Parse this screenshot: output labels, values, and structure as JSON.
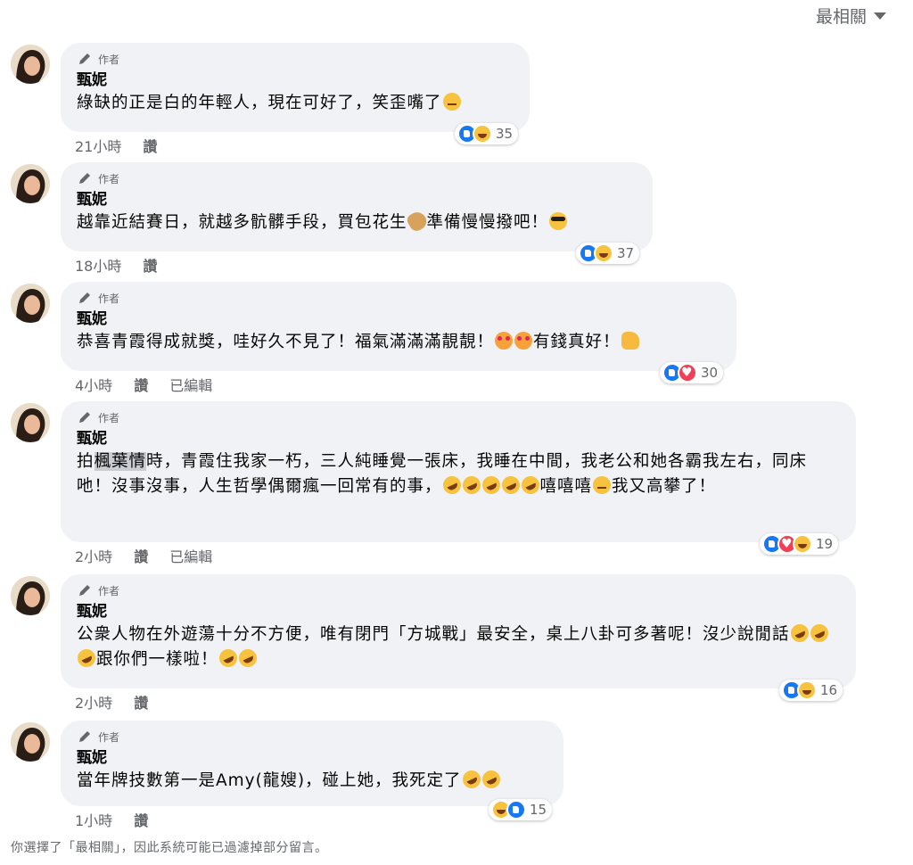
{
  "sort": {
    "label": "最相關"
  },
  "author_badge": "作者",
  "comments": [
    {
      "name": "甄妮",
      "text_parts": [
        "綠缺的正是白的年輕人，現在可好了，笑歪嘴了"
      ],
      "time": "21小時",
      "reply": "讚",
      "edited": "",
      "reaction_count": "35"
    },
    {
      "name": "甄妮",
      "text_parts": [
        "越靠近結賽日，就越多骯髒手段，買包花生",
        "準備慢慢撥吧！"
      ],
      "time": "18小時",
      "reply": "讚",
      "edited": "",
      "reaction_count": "37"
    },
    {
      "name": "甄妮",
      "text_parts": [
        "恭喜青霞得成就獎，哇好久不見了！福氣滿滿滿靚靚！",
        "有錢真好！"
      ],
      "time": "4小時",
      "reply": "讚",
      "edited": "已編輯",
      "reaction_count": "30"
    },
    {
      "name": "甄妮",
      "text_parts": [
        "拍",
        "楓葉情",
        "時，青霞住我家一朽，三人純睡覺一張床，我睡在中間，我老公和她各霸我左右，同床吔！沒事沒事，人生哲學偶爾瘋一回常有的事，",
        "嘻嘻嘻",
        "我又高攀了！"
      ],
      "time": "2小時",
      "reply": "讚",
      "edited": "已編輯",
      "reaction_count": "19"
    },
    {
      "name": "甄妮",
      "text_parts": [
        "公衆人物在外遊蕩十分不方便，唯有閉門「方城戰」最安全，桌上八卦可多著呢！沒少說閒話",
        "跟你們一樣啦！"
      ],
      "time": "2小時",
      "reply": "讚",
      "edited": "",
      "reaction_count": "16"
    },
    {
      "name": "甄妮",
      "text_parts": [
        "當年牌技數第一是Amy(龍嫂)，碰上她，我死定了"
      ],
      "time": "1小時",
      "reply": "讚",
      "edited": "",
      "reaction_count": "15"
    }
  ],
  "footer": "你選擇了「最相關」，因此系統可能已過濾掉部分留言。"
}
